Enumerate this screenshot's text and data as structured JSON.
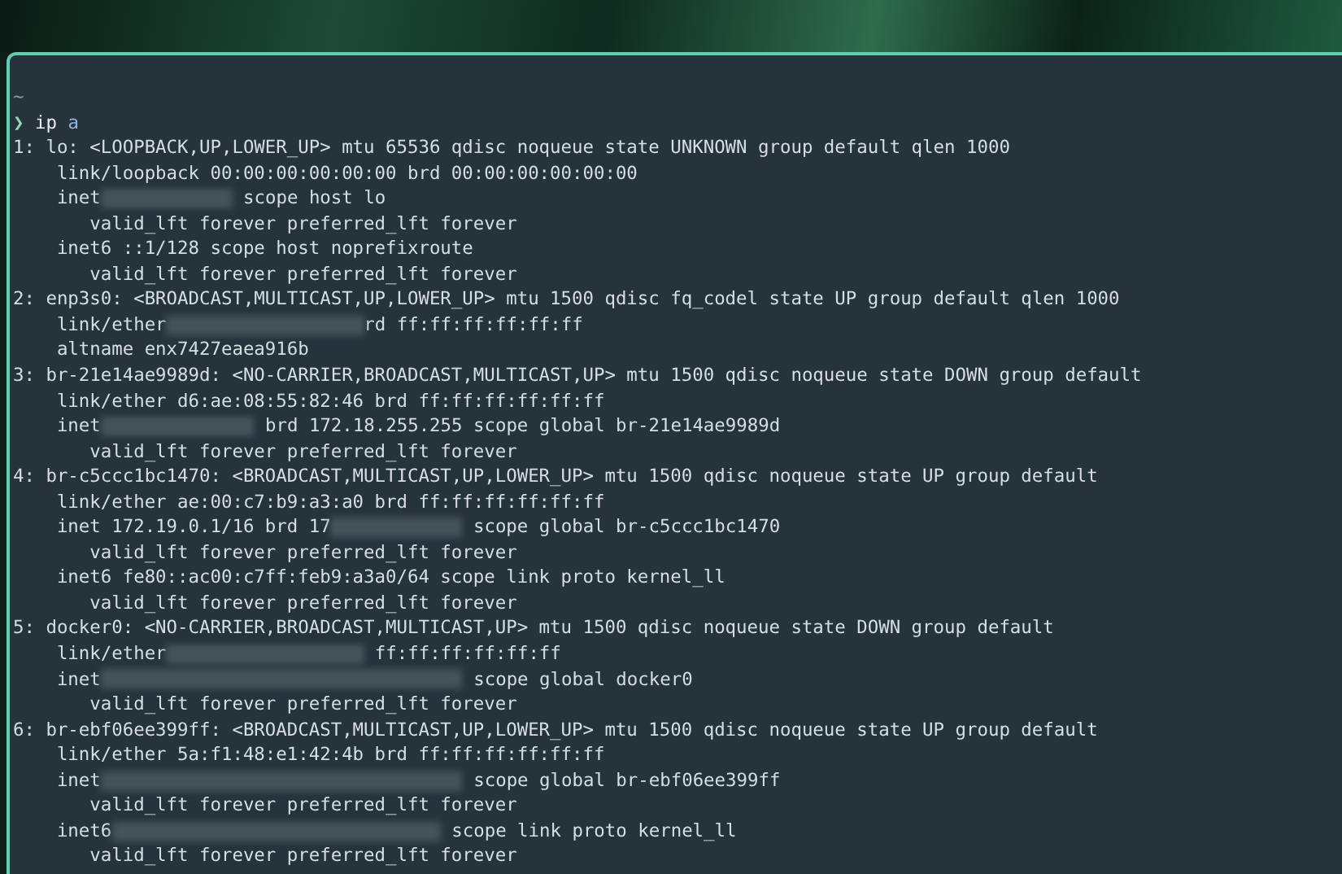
{
  "terminal": {
    "cwd": "~",
    "prompt": {
      "symbol": "❯",
      "command": "ip",
      "argument": "a"
    },
    "lines": [
      {
        "kind": "text",
        "text": "1: lo: <LOOPBACK,UP,LOWER_UP> mtu 65536 qdisc noqueue state UNKNOWN group default qlen 1000"
      },
      {
        "kind": "text",
        "text": "    link/loopback 00:00:00:00:00:00 brd 00:00:00:00:00:00"
      },
      {
        "kind": "redacted",
        "before": "    inet",
        "after": " scope host lo"
      },
      {
        "kind": "text",
        "text": "       valid_lft forever preferred_lft forever"
      },
      {
        "kind": "text",
        "text": "    inet6 ::1/128 scope host noprefixroute"
      },
      {
        "kind": "text",
        "text": "       valid_lft forever preferred_lft forever"
      },
      {
        "kind": "text",
        "text": "2: enp3s0: <BROADCAST,MULTICAST,UP,LOWER_UP> mtu 1500 qdisc fq_codel state UP group default qlen 1000"
      },
      {
        "kind": "redacted",
        "before": "    link/ether",
        "after": "rd ff:ff:ff:ff:ff:ff"
      },
      {
        "kind": "text",
        "text": "    altname enx7427eaea916b"
      },
      {
        "kind": "text",
        "text": "3: br-21e14ae9989d: <NO-CARRIER,BROADCAST,MULTICAST,UP> mtu 1500 qdisc noqueue state DOWN group default"
      },
      {
        "kind": "text",
        "text": "    link/ether d6:ae:08:55:82:46 brd ff:ff:ff:ff:ff:ff"
      },
      {
        "kind": "redacted",
        "before": "    inet",
        "after": " brd 172.18.255.255 scope global br-21e14ae9989d"
      },
      {
        "kind": "text",
        "text": "       valid_lft forever preferred_lft forever"
      },
      {
        "kind": "text",
        "text": "4: br-c5ccc1bc1470: <BROADCAST,MULTICAST,UP,LOWER_UP> mtu 1500 qdisc noqueue state UP group default"
      },
      {
        "kind": "text",
        "text": "    link/ether ae:00:c7:b9:a3:a0 brd ff:ff:ff:ff:ff:ff"
      },
      {
        "kind": "redacted",
        "before": "    inet 172.19.0.1/16 brd 17",
        "after": " scope global br-c5ccc1bc1470"
      },
      {
        "kind": "text",
        "text": "       valid_lft forever preferred_lft forever"
      },
      {
        "kind": "text",
        "text": "    inet6 fe80::ac00:c7ff:feb9:a3a0/64 scope link proto kernel_ll"
      },
      {
        "kind": "text",
        "text": "       valid_lft forever preferred_lft forever"
      },
      {
        "kind": "text",
        "text": "5: docker0: <NO-CARRIER,BROADCAST,MULTICAST,UP> mtu 1500 qdisc noqueue state DOWN group default"
      },
      {
        "kind": "redacted",
        "before": "    link/ether",
        "after": " ff:ff:ff:ff:ff:ff"
      },
      {
        "kind": "redacted",
        "before": "    inet",
        "after": " scope global docker0"
      },
      {
        "kind": "text",
        "text": "       valid_lft forever preferred_lft forever"
      },
      {
        "kind": "text",
        "text": "6: br-ebf06ee399ff: <BROADCAST,MULTICAST,UP,LOWER_UP> mtu 1500 qdisc noqueue state UP group default"
      },
      {
        "kind": "text",
        "text": "    link/ether 5a:f1:48:e1:42:4b brd ff:ff:ff:ff:ff:ff"
      },
      {
        "kind": "redacted",
        "before": "    inet",
        "after": " scope global br-ebf06ee399ff"
      },
      {
        "kind": "text",
        "text": "       valid_lft forever preferred_lft forever"
      },
      {
        "kind": "redacted",
        "before": "    inet6",
        "after": " scope link proto kernel_ll"
      },
      {
        "kind": "text",
        "text": "       valid_lft forever preferred_lft forever"
      }
    ]
  }
}
